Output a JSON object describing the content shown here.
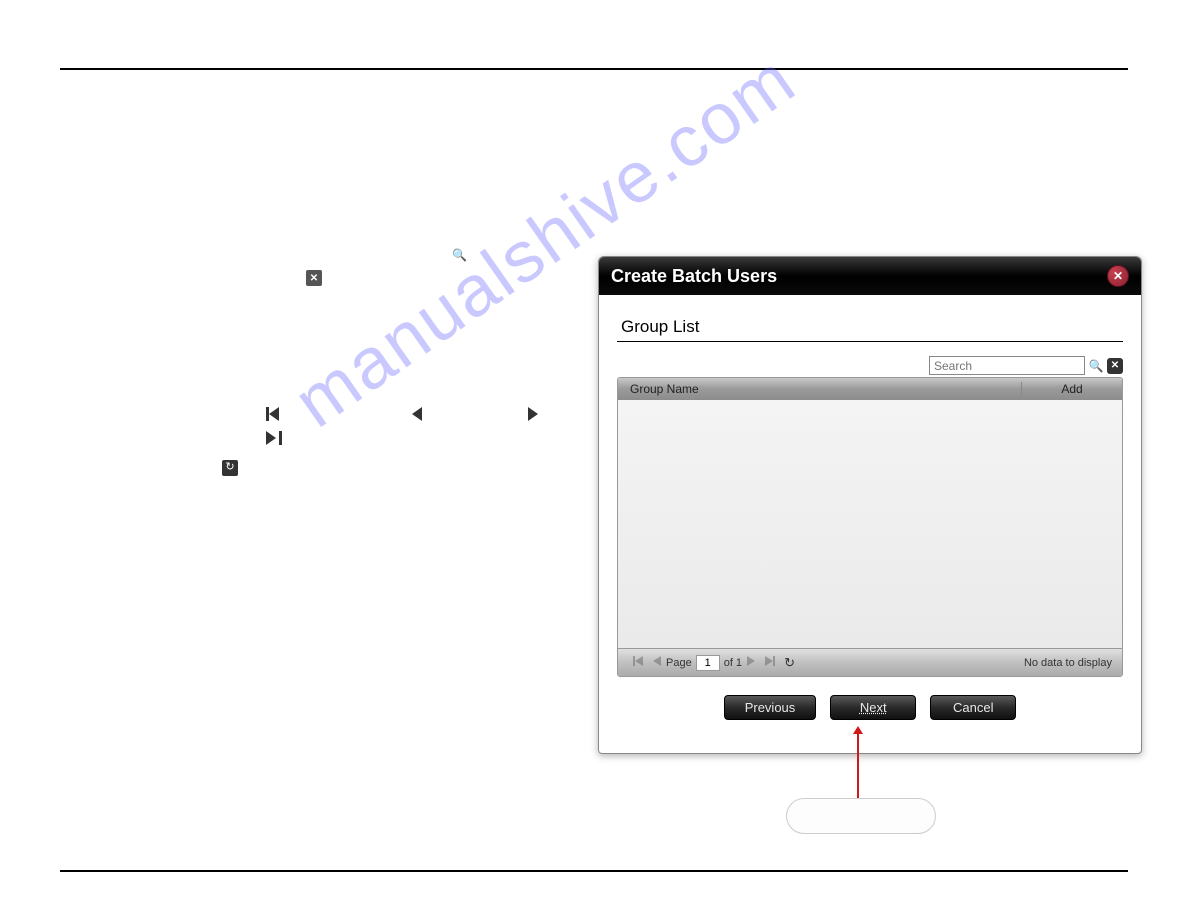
{
  "dialog": {
    "title": "Create Batch Users",
    "section_title": "Group List",
    "search": {
      "placeholder": "Search"
    },
    "columns": {
      "name": "Group Name",
      "add": "Add"
    },
    "pager": {
      "page_label": "Page",
      "current": "1",
      "of_label": "of 1",
      "empty_text": "No data to display"
    },
    "buttons": {
      "previous": "Previous",
      "next": "Next",
      "cancel": "Cancel"
    }
  }
}
